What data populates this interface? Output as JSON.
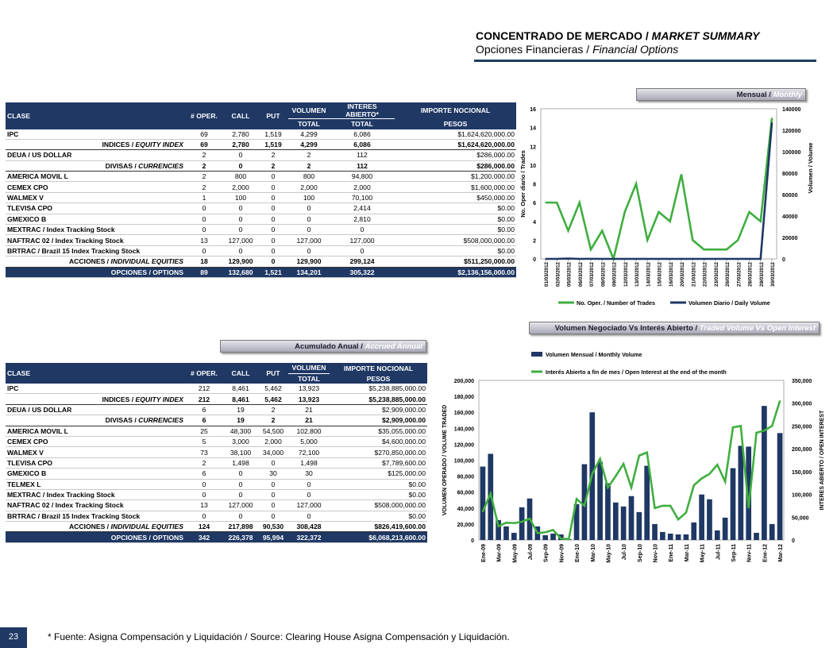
{
  "header": {
    "title_es": "CONCENTRADO DE MERCADO / ",
    "title_en": "MARKET SUMMARY",
    "subtitle_es": "Opciones Financieras / ",
    "subtitle_en": "Financial Options"
  },
  "tabs": {
    "monthly": {
      "es": "Mensual / ",
      "en": "Monthly"
    },
    "annual": {
      "es": "Acumulado Anual / ",
      "en": "Accrued Annual"
    },
    "volume_oi": {
      "es": "Volumen Negociado Vs Interés Abierto / ",
      "en": "Traded Volume Vs Open Interest"
    }
  },
  "monthly_table": {
    "headers": [
      "CLASE",
      "# OPER.",
      "CALL",
      "PUT",
      "VOLUMEN",
      "TOTAL",
      "INTERES ABIERTO*",
      "TOTAL",
      "IMPORTE NOCIONAL",
      "PESOS"
    ],
    "rows": [
      {
        "type": "d",
        "clase": "IPC",
        "oper": "69",
        "call": "2,780",
        "put": "1,519",
        "vol": "4,299",
        "ia": "6,086",
        "imp": "$1,624,620,000.00"
      },
      {
        "type": "sub",
        "label_es": "INDICES / ",
        "label_en": "EQUITY INDEX",
        "oper": "69",
        "call": "2,780",
        "put": "1,519",
        "vol": "4,299",
        "ia": "6,086",
        "imp": "$1,624,620,000.00"
      },
      {
        "type": "d",
        "clase": "DEUA / US DOLLAR",
        "oper": "2",
        "call": "0",
        "put": "2",
        "vol": "2",
        "ia": "112",
        "imp": "$286,000.00"
      },
      {
        "type": "sub",
        "label_es": "DIVISAS / ",
        "label_en": "CURRENCIES",
        "oper": "2",
        "call": "0",
        "put": "2",
        "vol": "2",
        "ia": "112",
        "imp": "$286,000.00"
      },
      {
        "type": "d",
        "clase": "AMERICA MOVIL L",
        "oper": "2",
        "call": "800",
        "put": "0",
        "vol": "800",
        "ia": "94,800",
        "imp": "$1,200,000.00"
      },
      {
        "type": "d",
        "clase": "CEMEX CPO",
        "oper": "2",
        "call": "2,000",
        "put": "0",
        "vol": "2,000",
        "ia": "2,000",
        "imp": "$1,600,000.00"
      },
      {
        "type": "d",
        "clase": "WALMEX V",
        "oper": "1",
        "call": "100",
        "put": "0",
        "vol": "100",
        "ia": "70,100",
        "imp": "$450,000.00"
      },
      {
        "type": "d",
        "clase": "TLEVISA CPO",
        "oper": "0",
        "call": "0",
        "put": "0",
        "vol": "0",
        "ia": "2,414",
        "imp": "$0.00"
      },
      {
        "type": "d",
        "clase": "GMEXICO B",
        "oper": "0",
        "call": "0",
        "put": "0",
        "vol": "0",
        "ia": "2,810",
        "imp": "$0.00"
      },
      {
        "type": "d",
        "clase": "MEXTRAC / Index Tracking Stock",
        "oper": "0",
        "call": "0",
        "put": "0",
        "vol": "0",
        "ia": "0",
        "imp": "$0.00"
      },
      {
        "type": "d",
        "clase": "NAFTRAC 02 / Index Tracking Stock",
        "oper": "13",
        "call": "127,000",
        "put": "0",
        "vol": "127,000",
        "ia": "127,000",
        "imp": "$508,000,000.00"
      },
      {
        "type": "d",
        "clase": "BRTRAC / Brazil 15 Index Tracking Stock",
        "oper": "0",
        "call": "0",
        "put": "0",
        "vol": "0",
        "ia": "0",
        "imp": "$0.00"
      },
      {
        "type": "sub",
        "label_es": "ACCIONES / ",
        "label_en": "INDIVIDUAL EQUITIES",
        "oper": "18",
        "call": "129,900",
        "put": "0",
        "vol": "129,900",
        "ia": "299,124",
        "imp": "$511,250,000.00"
      },
      {
        "type": "tot",
        "label": "OPCIONES / OPTIONS",
        "oper": "89",
        "call": "132,680",
        "put": "1,521",
        "vol": "134,201",
        "ia": "305,322",
        "imp": "$2,136,156,000.00"
      }
    ]
  },
  "annual_table": {
    "headers": [
      "CLASE",
      "# OPER.",
      "CALL",
      "PUT",
      "VOLUMEN",
      "TOTAL",
      "IMPORTE NOCIONAL",
      "PESOS"
    ],
    "rows": [
      {
        "type": "d",
        "clase": "IPC",
        "oper": "212",
        "call": "8,461",
        "put": "5,462",
        "vol": "13,923",
        "imp": "$5,238,885,000.00"
      },
      {
        "type": "sub",
        "label_es": "INDICES / ",
        "label_en": "EQUITY INDEX",
        "oper": "212",
        "call": "8,461",
        "put": "5,462",
        "vol": "13,923",
        "imp": "$5,238,885,000.00"
      },
      {
        "type": "d",
        "clase": "DEUA / US DOLLAR",
        "oper": "6",
        "call": "19",
        "put": "2",
        "vol": "21",
        "imp": "$2,909,000.00"
      },
      {
        "type": "sub",
        "label_es": "DIVISAS / ",
        "label_en": "CURRENCIES",
        "oper": "6",
        "call": "19",
        "put": "2",
        "vol": "21",
        "imp": "$2,909,000.00"
      },
      {
        "type": "d",
        "clase": "AMERICA MOVIL L",
        "oper": "25",
        "call": "48,300",
        "put": "54,500",
        "vol": "102,800",
        "imp": "$35,055,000.00"
      },
      {
        "type": "d",
        "clase": "CEMEX CPO",
        "oper": "5",
        "call": "3,000",
        "put": "2,000",
        "vol": "5,000",
        "imp": "$4,600,000.00"
      },
      {
        "type": "d",
        "clase": "WALMEX V",
        "oper": "73",
        "call": "38,100",
        "put": "34,000",
        "vol": "72,100",
        "imp": "$270,850,000.00"
      },
      {
        "type": "d",
        "clase": "TLEVISA CPO",
        "oper": "2",
        "call": "1,498",
        "put": "0",
        "vol": "1,498",
        "imp": "$7,789,600.00"
      },
      {
        "type": "d",
        "clase": "GMEXICO B",
        "oper": "6",
        "call": "0",
        "put": "30",
        "vol": "30",
        "imp": "$125,000.00"
      },
      {
        "type": "d",
        "clase": "TELMEX L",
        "oper": "0",
        "call": "0",
        "put": "0",
        "vol": "0",
        "imp": "$0.00"
      },
      {
        "type": "d",
        "clase": "MEXTRAC / Index Tracking Stock",
        "oper": "0",
        "call": "0",
        "put": "0",
        "vol": "0",
        "imp": "$0.00"
      },
      {
        "type": "d",
        "clase": "NAFTRAC 02 / Index Tracking Stock",
        "oper": "13",
        "call": "127,000",
        "put": "0",
        "vol": "127,000",
        "imp": "$508,000,000.00"
      },
      {
        "type": "d",
        "clase": "BRTRAC / Brazil 15 Index Tracking Stock",
        "oper": "0",
        "call": "0",
        "put": "0",
        "vol": "0",
        "imp": "$0.00"
      },
      {
        "type": "sub",
        "label_es": "ACCIONES / ",
        "label_en": "INDIVIDUAL EQUITIES",
        "oper": "124",
        "call": "217,898",
        "put": "90,530",
        "vol": "308,428",
        "imp": "$826,419,600.00"
      },
      {
        "type": "tot",
        "label": "OPCIONES / OPTIONS",
        "oper": "342",
        "call": "226,378",
        "put": "95,994",
        "vol": "322,372",
        "imp": "$6,068,213,600.00"
      }
    ]
  },
  "chart_data": [
    {
      "type": "line",
      "x": [
        "01/03/2012",
        "02/03/2012",
        "05/03/2012",
        "06/03/2012",
        "07/03/2012",
        "08/03/2012",
        "09/03/2012",
        "12/03/2012",
        "13/03/2012",
        "14/03/2012",
        "15/03/2012",
        "16/03/2012",
        "20/03/2012",
        "21/03/2012",
        "22/03/2012",
        "23/03/2012",
        "26/03/2012",
        "27/03/2012",
        "28/03/2012",
        "29/03/2012",
        "30/03/2012"
      ],
      "series": [
        {
          "name": "No. Oper. / Number of Trades",
          "axis": "left",
          "color": "#3fae3f",
          "values": [
            6,
            6,
            3,
            6,
            1,
            3,
            0,
            5,
            8,
            2,
            5,
            4,
            9,
            2,
            1,
            1,
            1,
            2,
            5,
            4,
            15
          ]
        },
        {
          "name": "Volumen Diario / Daily Volume",
          "axis": "right",
          "color": "#1f3864",
          "values": [
            0,
            0,
            300,
            0,
            100,
            0,
            0,
            0,
            0,
            0,
            0,
            0,
            0,
            0,
            0,
            0,
            0,
            0,
            0,
            0,
            127000
          ]
        }
      ],
      "ylabel": "No. Oper diario / Trades",
      "y2label": "Volumen / Volume",
      "ylim": [
        0,
        16
      ],
      "y2lim": [
        0,
        140000
      ],
      "yticks": [
        "0",
        "2",
        "4",
        "6",
        "8",
        "10",
        "12",
        "14",
        "16"
      ],
      "y2ticks": [
        "0",
        "20000",
        "40000",
        "60000",
        "80000",
        "100000",
        "120000",
        "140000"
      ],
      "legend": "bottom"
    },
    {
      "type": "bar",
      "x": [
        "Ene-09",
        "Feb-09",
        "Mar-09",
        "Abr-09",
        "May-09",
        "Jun-09",
        "Jul-09",
        "Ago-09",
        "Sep-09",
        "Oct-09",
        "Nov-09",
        "Dic-09",
        "Ene-10",
        "Feb-10",
        "Mar-10",
        "Abr-10",
        "May-10",
        "Jun-10",
        "Jul-10",
        "Ago-10",
        "Sep-10",
        "Oct-10",
        "Nov-10",
        "Dic-10",
        "Ene-11",
        "Feb-11",
        "Mar-11",
        "Abr-11",
        "May-11",
        "Jun-11",
        "Jul-11",
        "Ago-11",
        "Sep-11",
        "Oct-11",
        "Nov-11",
        "Dic-11",
        "Ene-12",
        "Feb-12",
        "Mar-12"
      ],
      "xtick_labels": [
        "Ene-09",
        "Mar-09",
        "May-09",
        "Jul-09",
        "Sep-09",
        "Nov-09",
        "Ene-10",
        "Mar-10",
        "May-10",
        "Jul-10",
        "Sep-10",
        "Nov-10",
        "Ene-11",
        "Mar-11",
        "May-11",
        "Jul-11",
        "Sep-11",
        "Nov-11",
        "Ene-12",
        "Mar-12"
      ],
      "series": [
        {
          "name": "Volumen Mensual / Monthly Volume",
          "axis": "left",
          "kind": "bar",
          "color": "#1f3864",
          "values": [
            92000,
            108000,
            25000,
            17000,
            9000,
            41000,
            52000,
            17000,
            6000,
            8000,
            7000,
            1000,
            45000,
            95000,
            160000,
            98000,
            71000,
            47000,
            42000,
            55000,
            35000,
            93000,
            20000,
            10000,
            8000,
            7000,
            7000,
            22000,
            57000,
            51000,
            12000,
            28000,
            90000,
            118000,
            117000,
            9000,
            168000,
            20000,
            134000
          ]
        },
        {
          "name": "Interés Abierto a fin de mes / Open Interest at the end of the month",
          "axis": "right",
          "kind": "line",
          "color": "#3fae3f",
          "values": [
            62000,
            102000,
            30000,
            38000,
            37000,
            40000,
            47000,
            15000,
            17000,
            22000,
            3000,
            2000,
            90000,
            75000,
            145000,
            178000,
            115000,
            140000,
            167000,
            115000,
            185000,
            192000,
            70000,
            75000,
            75000,
            45000,
            60000,
            120000,
            135000,
            145000,
            165000,
            128000,
            247000,
            250000,
            70000,
            235000,
            240000,
            250000,
            305000
          ]
        }
      ],
      "ylabel": "VOLUMEN OPERADO / VOLUME TRADED",
      "y2label": "INTERES ABIERTO / OPEN INTEREST",
      "ylim": [
        0,
        200000
      ],
      "y2lim": [
        0,
        350000
      ],
      "yticks": [
        "0",
        "20,000",
        "40,000",
        "60,000",
        "80,000",
        "100,000",
        "120,000",
        "140,000",
        "160,000",
        "180,000",
        "200,000"
      ],
      "y2ticks": [
        "0",
        "50,000",
        "100,000",
        "150,000",
        "200,000",
        "250,000",
        "300,000",
        "350,000"
      ],
      "legend": "top-left"
    }
  ],
  "footer": {
    "page_number": "23",
    "note": "* Fuente: Asigna Compensación y Liquidación / Source: Clearing House Asigna Compensación y Liquidación."
  }
}
